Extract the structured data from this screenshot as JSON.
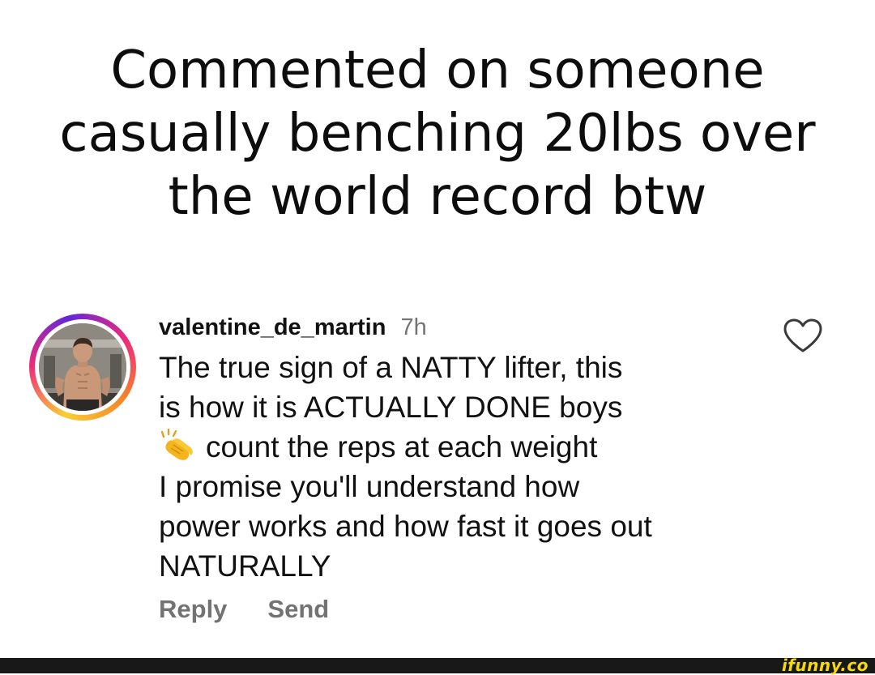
{
  "caption": {
    "lines": [
      "Commented on someone",
      "casually benching 20lbs over",
      "the world record btw"
    ]
  },
  "comment": {
    "username": "valentine_de_martin",
    "time": "7h",
    "body_lines": [
      "The true sign of a NATTY lifter, this",
      "is how it is ACTUALLY DONE boys",
      "count the reps at each weight",
      "I promise you'll understand how",
      "power works and how fast it goes out",
      "NATURALLY"
    ],
    "emoji_icon": "clapping-hands-icon",
    "actions": {
      "reply": "Reply",
      "send": "Send"
    },
    "like_icon": "heart-outline-icon",
    "avatar_icon": "profile-photo"
  },
  "watermark": "ifunny.co",
  "colors": {
    "text": "#111111",
    "muted": "#737373",
    "footer": "#181818",
    "watermark": "#f5d90a",
    "ring_start": "#f9ce34",
    "ring_mid": "#ee2a7b",
    "ring_end": "#6228d7"
  }
}
